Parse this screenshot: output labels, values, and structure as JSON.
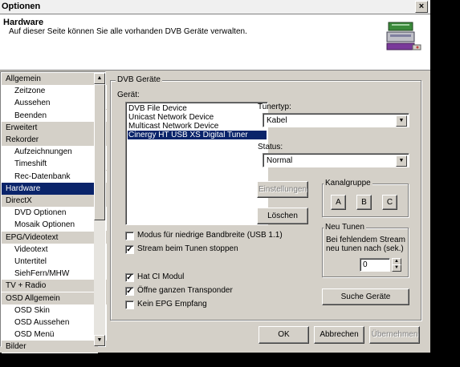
{
  "window": {
    "title": "Optionen",
    "close": "×"
  },
  "header": {
    "title": "Hardware",
    "subtitle": "Auf dieser Seite können Sie alle vorhanden DVB Geräte verwalten."
  },
  "sidebar": {
    "items": [
      {
        "label": "Allgemein",
        "kind": "cat"
      },
      {
        "label": "Zeitzone",
        "kind": "sub"
      },
      {
        "label": "Aussehen",
        "kind": "sub"
      },
      {
        "label": "Beenden",
        "kind": "sub"
      },
      {
        "label": "Erweitert",
        "kind": "cat"
      },
      {
        "label": "Rekorder",
        "kind": "cat"
      },
      {
        "label": "Aufzeichnungen",
        "kind": "sub"
      },
      {
        "label": "Timeshift",
        "kind": "sub"
      },
      {
        "label": "Rec-Datenbank",
        "kind": "sub"
      },
      {
        "label": "Hardware",
        "kind": "cat",
        "selected": true
      },
      {
        "label": "DirectX",
        "kind": "cat"
      },
      {
        "label": "DVD Optionen",
        "kind": "sub"
      },
      {
        "label": "Mosaik Optionen",
        "kind": "sub"
      },
      {
        "label": "EPG/Videotext",
        "kind": "cat"
      },
      {
        "label": "Videotext",
        "kind": "sub"
      },
      {
        "label": "Untertitel",
        "kind": "sub"
      },
      {
        "label": "SiehFern/MHW",
        "kind": "sub"
      },
      {
        "label": "TV + Radio",
        "kind": "cat"
      },
      {
        "label": "OSD Allgemein",
        "kind": "cat"
      },
      {
        "label": "OSD Skin",
        "kind": "sub"
      },
      {
        "label": "OSD Aussehen",
        "kind": "sub"
      },
      {
        "label": "OSD Menü",
        "kind": "sub"
      },
      {
        "label": "Bilder",
        "kind": "cat"
      }
    ]
  },
  "dvb": {
    "group_title": "DVB Geräte",
    "device_label": "Gerät:",
    "devices": [
      "DVB File Device",
      "Unicast Network Device",
      "Multicast Network Device",
      "Cinergy HT USB XS Digital Tuner"
    ],
    "selected_device": 3,
    "tunertyp_label": "Tunertyp:",
    "tunertyp_value": "Kabel",
    "status_label": "Status:",
    "status_value": "Normal",
    "einstellungen": "Einstellungen",
    "loeschen": "Löschen",
    "kanalgruppe_title": "Kanalgruppe",
    "kanal_a": "A",
    "kanal_b": "B",
    "kanal_c": "C",
    "neu_tunen_title": "Neu Tunen",
    "neu_tunen_text1": "Bei fehlendem Stream",
    "neu_tunen_text2": "neu tunen nach (sek.)",
    "neu_tunen_value": "0",
    "suche": "Suche Geräte",
    "checkboxes": [
      {
        "label": "Modus für niedrige Bandbreite (USB 1.1)",
        "checked": false
      },
      {
        "label": "Stream beim Tunen stoppen",
        "checked": true
      },
      {
        "label": "Hat CI Modul",
        "checked": true
      },
      {
        "label": "Öffne ganzen Transponder",
        "checked": true
      },
      {
        "label": "Kein EPG Empfang",
        "checked": false
      }
    ]
  },
  "footer": {
    "ok": "OK",
    "abbrechen": "Abbrechen",
    "uebernehmen": "Übernehmen"
  }
}
